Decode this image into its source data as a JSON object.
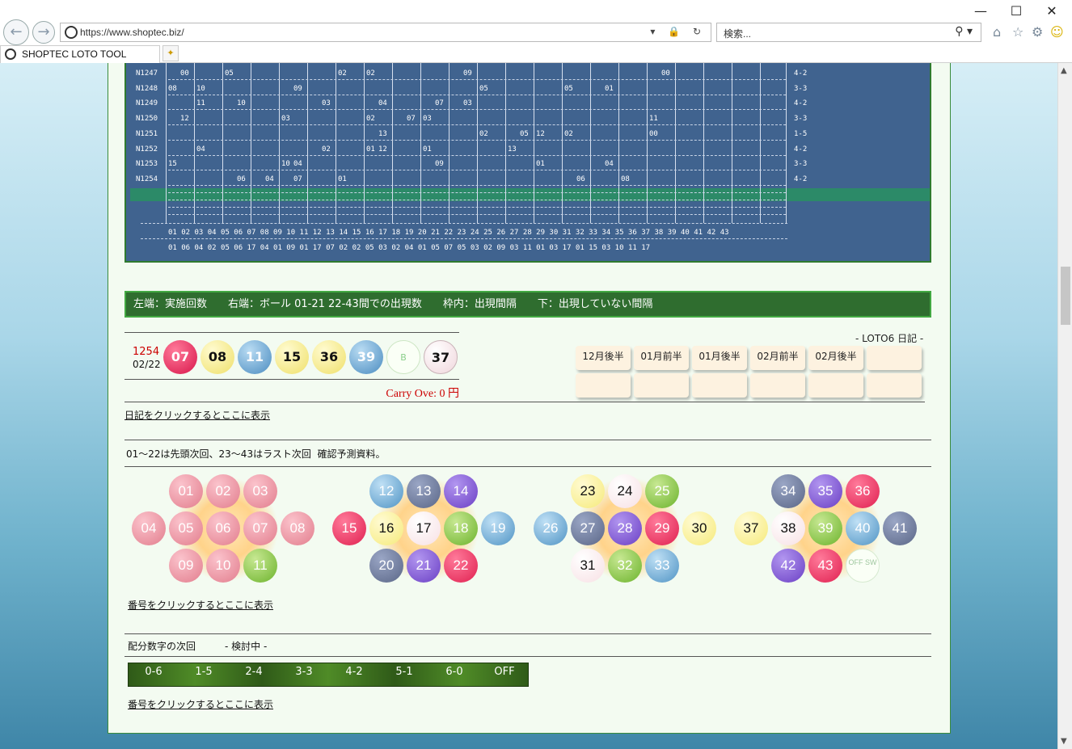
{
  "browser": {
    "url": "https://www.shoptec.biz/",
    "search_placeholder": "検索...",
    "tab_title": "SHOPTEC LOTO TOOL"
  },
  "grid": {
    "rows": [
      {
        "label": "N1247",
        "ratio": "4-2"
      },
      {
        "label": "N1248",
        "ratio": "3-3"
      },
      {
        "label": "N1249",
        "ratio": "4-2"
      },
      {
        "label": "N1250",
        "ratio": "3-3"
      },
      {
        "label": "N1251",
        "ratio": "1-5"
      },
      {
        "label": "N1252",
        "ratio": "4-2"
      },
      {
        "label": "N1253",
        "ratio": "3-3"
      },
      {
        "label": "N1254",
        "ratio": "4-2"
      }
    ],
    "cells": [
      [
        "",
        "00",
        "",
        "05",
        "",
        "",
        "",
        "",
        "",
        "02",
        "02",
        "",
        "",
        "",
        "",
        "09",
        "",
        "",
        "",
        "",
        "",
        "",
        "",
        "",
        "",
        "00",
        "",
        "",
        "",
        "",
        ""
      ],
      [
        "08",
        "",
        "10",
        "",
        "",
        "",
        "",
        "09",
        "",
        "",
        "",
        "",
        "",
        "",
        "",
        "",
        "05",
        "",
        "",
        "",
        "05",
        "",
        "01",
        "",
        "",
        "",
        "",
        "",
        "",
        "",
        ""
      ],
      [
        "",
        "",
        "11",
        "",
        "10",
        "",
        "",
        "",
        "03",
        "",
        "",
        "04",
        "",
        "",
        "07",
        "03",
        "",
        "",
        "",
        "",
        "",
        "",
        "",
        "",
        "",
        "",
        "",
        "",
        "",
        "",
        ""
      ],
      [
        "",
        "12",
        "",
        "",
        "",
        "",
        "03",
        "",
        "",
        "",
        "02",
        "",
        "07",
        "03",
        "",
        "",
        "",
        "",
        "",
        "",
        "",
        "",
        "",
        "",
        "11",
        "",
        "",
        "",
        "",
        "",
        ""
      ],
      [
        "",
        "",
        "",
        "",
        "",
        "",
        "",
        "",
        "",
        "",
        "",
        "13",
        "",
        "",
        "",
        "",
        "02",
        "",
        "05",
        "12",
        "02",
        "",
        "",
        "",
        "00",
        "",
        "",
        "",
        "",
        "",
        ""
      ],
      [
        "",
        "",
        "04",
        "",
        "",
        "",
        "",
        "",
        "02",
        "",
        "01",
        "12",
        "",
        "01",
        "",
        "",
        "",
        "13",
        "",
        "",
        "",
        "",
        "",
        "",
        "",
        "",
        "",
        "",
        "",
        "",
        ""
      ],
      [
        "15",
        "",
        "",
        "",
        "",
        "",
        "10",
        "04",
        "",
        "",
        "",
        "",
        "",
        "",
        "09",
        "",
        "",
        "",
        "",
        "01",
        "",
        "",
        "04",
        "",
        "",
        "",
        "",
        "",
        "",
        "",
        ""
      ],
      [
        "",
        "",
        "",
        "",
        "06",
        "04",
        "",
        "07",
        "",
        "01",
        "",
        "",
        "",
        "",
        "",
        "",
        "",
        "",
        "",
        "",
        "",
        "06",
        "",
        "08",
        "",
        "",
        "",
        "",
        "",
        "",
        ""
      ]
    ],
    "axis_numbers": "01 02 03 04 05 06 07 08 09 10 11 12 13 14 15 16 17 18 19 20 21 22 23 24 25 26 27 28 29 30 31 32 33 34 35 36 37 38 39 40 41 42 43",
    "axis_gaps": "01 06 04 02 05 06       17 04    01 09 01    17 07 02 02 05 03 02 04 01 05 07 05 03 02 09 03 11 01 03 17    01 15    03 10 11 17"
  },
  "info_bar": "左端：実施回数　　右端：ボール 01-21 22-43間での出現数　　枠内：出現間隔　　下：出現していない間隔",
  "latest_draw": {
    "number": "1254",
    "date": "02/22",
    "balls": [
      "07",
      "08",
      "11",
      "15",
      "36",
      "39"
    ],
    "bonus_label": "B",
    "bonus": "37",
    "carry_over": "Carry Ove: 0 円"
  },
  "diary": {
    "title": "- LOTO6 日記 -",
    "buttons": [
      "12月後半",
      "01月前半",
      "01月後半",
      "02月前半",
      "02月後半",
      "",
      "",
      "",
      "",
      "",
      "",
      ""
    ],
    "link": "日記をクリックするとここに表示"
  },
  "prediction_note": "01～22は先頭次回、23～43はラスト次回  確認予測資料。",
  "clusters": [
    [
      "01",
      "02",
      "03",
      "04",
      "05",
      "06",
      "07",
      "08",
      "09",
      "10",
      "11"
    ],
    [
      "12",
      "13",
      "14",
      "15",
      "16",
      "17",
      "18",
      "19",
      "20",
      "21",
      "22"
    ],
    [
      "23",
      "24",
      "25",
      "26",
      "27",
      "28",
      "29",
      "30",
      "31",
      "32",
      "33"
    ],
    [
      "34",
      "35",
      "36",
      "37",
      "38",
      "39",
      "40",
      "41",
      "42",
      "43",
      "OFF SW"
    ]
  ],
  "number_link": "番号をクリックするとここに表示",
  "distribution": {
    "label": "配分数字の次回",
    "status": "- 検討中 -",
    "items": [
      "0-6",
      "1-5",
      "2-4",
      "3-3",
      "4-2",
      "5-1",
      "6-0",
      "OFF"
    ],
    "link": "番号をクリックするとここに表示"
  },
  "colors": {
    "red": "#e02050",
    "yellow": "#f6ea7a",
    "blue": "#4f93c4",
    "green": "#6cb32c",
    "purple": "#6a3fc4",
    "slate": "#5a6687",
    "pink": "#f7e0e4",
    "rose": "#e27d8d",
    "page_bg": "#f3fbf1",
    "grid_bg": "#40638f"
  }
}
